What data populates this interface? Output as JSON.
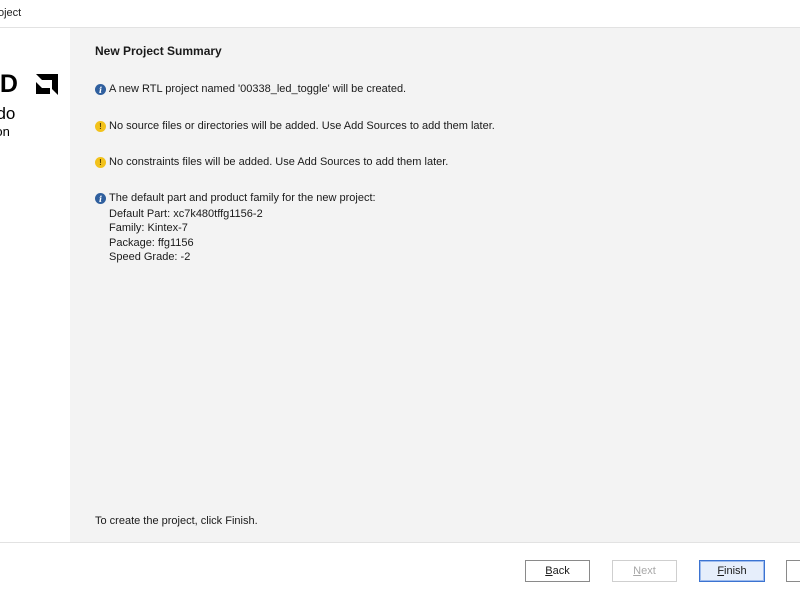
{
  "window": {
    "title": "oject"
  },
  "sidebar": {
    "brand": "MD",
    "product": "ado",
    "edition": "ition"
  },
  "main": {
    "title": "New Project Summary",
    "messages": [
      {
        "type": "info",
        "icon": "info-icon",
        "text": "A new RTL project named '00338_led_toggle' will be created."
      },
      {
        "type": "warning",
        "icon": "warning-icon",
        "text": "No source files or directories will be added. Use Add Sources to add them later."
      },
      {
        "type": "warning",
        "icon": "warning-icon",
        "text": "No constraints files will be added. Use Add Sources to add them later."
      },
      {
        "type": "info",
        "icon": "info-icon",
        "text": "The default part and product family for the new project:"
      }
    ],
    "part_details": [
      "Default Part: xc7k480tffg1156-2",
      "Family: Kintex-7",
      "Package: ffg1156",
      "Speed Grade: -2"
    ],
    "footer_text": "To create the project, click Finish."
  },
  "buttons": {
    "back": {
      "mnemonic": "B",
      "rest": "ack"
    },
    "next": {
      "mnemonic": "N",
      "rest": "ext"
    },
    "finish": {
      "mnemonic": "F",
      "rest": "inish"
    }
  },
  "colors": {
    "info": "#2f5f9e",
    "warning": "#f2c21b",
    "accent": "#3b73d1",
    "panel": "#f3f3f3"
  }
}
